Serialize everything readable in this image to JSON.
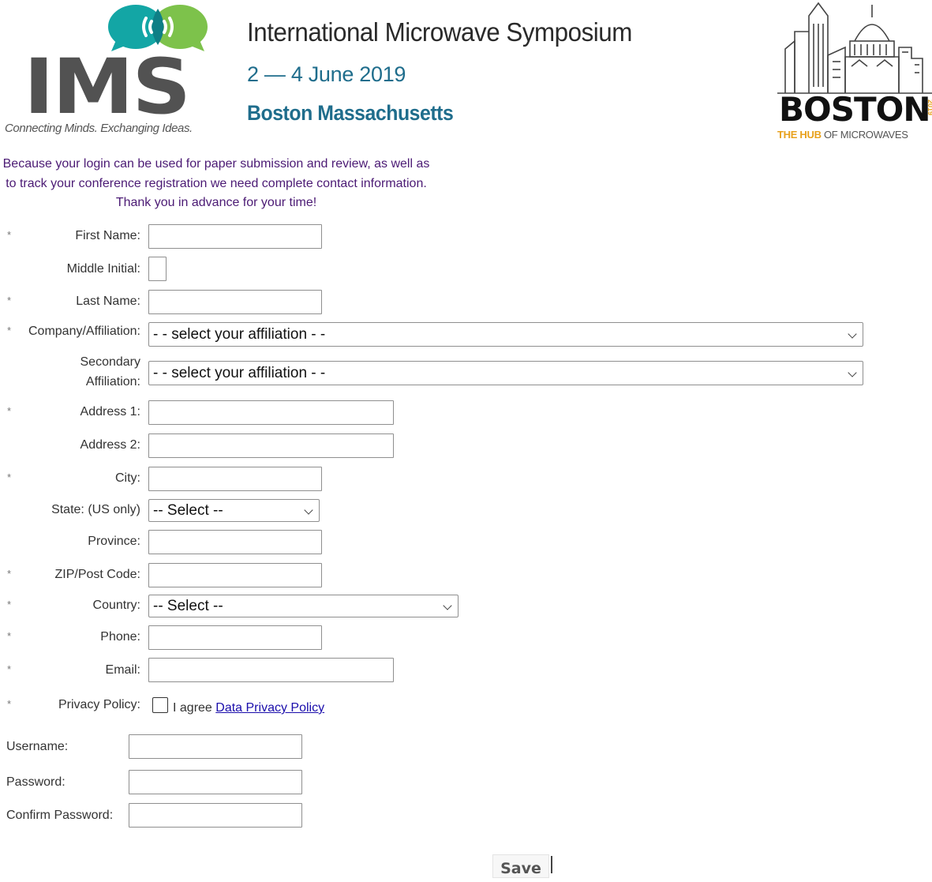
{
  "header": {
    "logo_text": "IMS",
    "tagline": "Connecting Minds. Exchanging Ideas.",
    "title": "International Microwave Symposium",
    "dates": "2 — 4 June 2019",
    "location": "Boston Massachusetts",
    "boston_logo": {
      "word": "BOSTON",
      "subtitle_highlight": "THE HUB",
      "subtitle_rest": " OF MICROWAVES",
      "year": "2019"
    }
  },
  "intro_text": "Because your login can be used for paper submission and review, as well as to track your conference registration we need complete contact information. Thank you in advance for your time!",
  "required_marker": "*",
  "form": {
    "first_name": {
      "label": "First Name:",
      "value": ""
    },
    "middle_initial": {
      "label": "Middle Initial:",
      "value": ""
    },
    "last_name": {
      "label": "Last Name:",
      "value": ""
    },
    "company": {
      "label": "Company/Affiliation:",
      "selected": "- - select your affiliation - -"
    },
    "secondary_affiliation": {
      "label_line1": "Secondary",
      "label_line2": "Affiliation:",
      "selected": "- - select your affiliation - -"
    },
    "address1": {
      "label": "Address 1:",
      "value": ""
    },
    "address2": {
      "label": "Address 2:",
      "value": ""
    },
    "city": {
      "label": "City:",
      "value": ""
    },
    "state": {
      "label": "State: (US only)",
      "selected": "-- Select --"
    },
    "province": {
      "label": "Province:",
      "value": ""
    },
    "zip": {
      "label": "ZIP/Post Code:",
      "value": ""
    },
    "country": {
      "label": "Country:",
      "selected": "-- Select --"
    },
    "phone": {
      "label": "Phone:",
      "value": ""
    },
    "email": {
      "label": "Email:",
      "value": ""
    },
    "privacy": {
      "label": "Privacy Policy:",
      "agree_text": "I agree",
      "link_text": "Data Privacy Policy",
      "checked": false
    },
    "username": {
      "label": "Username:",
      "value": ""
    },
    "password": {
      "label": "Password:",
      "value": ""
    },
    "confirm_password": {
      "label": "Confirm Password:",
      "value": ""
    }
  },
  "save_label": "Save",
  "colors": {
    "ims_bubble_teal": "#13a6a5",
    "ims_bubble_green": "#7dc24b",
    "ims_blue": "#1f6d8c",
    "intro_purple": "#4b1a74",
    "boston_orange": "#e8a11c",
    "link_blue": "#1a0dab"
  },
  "icons": {
    "ims_logo_mark": "speech-bubbles-wireless-icon",
    "boston_skyline": "boston-skyline-icon",
    "dropdown_chevron": "chevron-down-icon"
  }
}
